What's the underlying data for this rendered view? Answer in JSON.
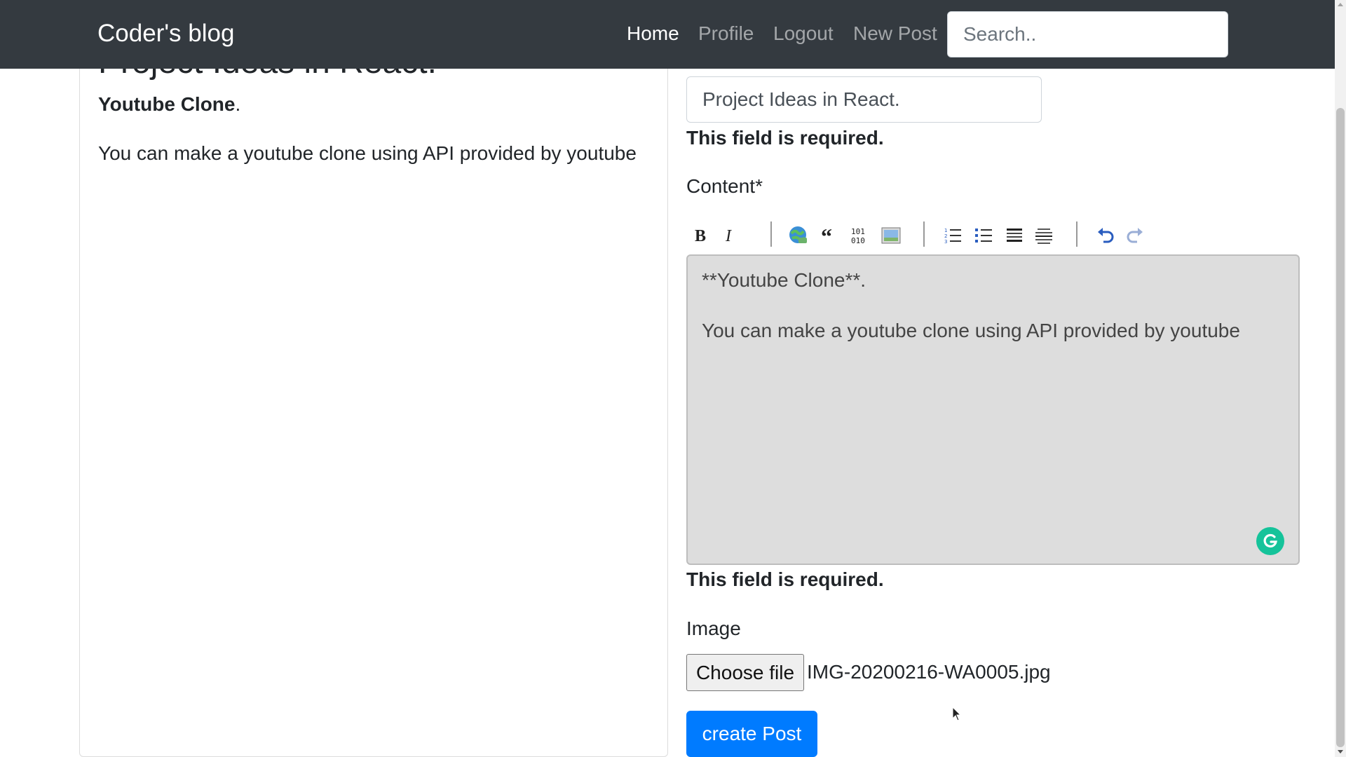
{
  "navbar": {
    "brand": "Coder's blog",
    "links": [
      "Home",
      "Profile",
      "Logout",
      "New Post"
    ],
    "active_link": "Home",
    "search_placeholder": "Search.."
  },
  "preview": {
    "title": "Project Ideas in React.",
    "bold_text": "Youtube Clone",
    "bold_suffix": ".",
    "body": "You can make a youtube clone using API provided by youtube"
  },
  "form": {
    "title_value": "Project Ideas in React.",
    "title_error": "This field is required.",
    "content_label": "Content*",
    "content_value": "**Youtube Clone**.\n\nYou can make a youtube clone using API provided by youtube",
    "content_error": "This field is required.",
    "image_label": "Image",
    "choose_file_label": "Choose file",
    "file_name": "IMG-20200216-WA0005.jpg",
    "submit_label": "create Post"
  },
  "toolbar": {
    "buttons": [
      "bold-icon",
      "italic-icon",
      "link-icon",
      "quote-icon",
      "code-icon",
      "image-icon",
      "ordered-list-icon",
      "unordered-list-icon",
      "heading-icon",
      "horizontal-rule-icon",
      "undo-icon",
      "redo-icon"
    ]
  },
  "colors": {
    "navbar_bg": "#343a40",
    "primary": "#007bff",
    "editor_bg": "#dddddd",
    "grammarly": "#15c39a"
  }
}
